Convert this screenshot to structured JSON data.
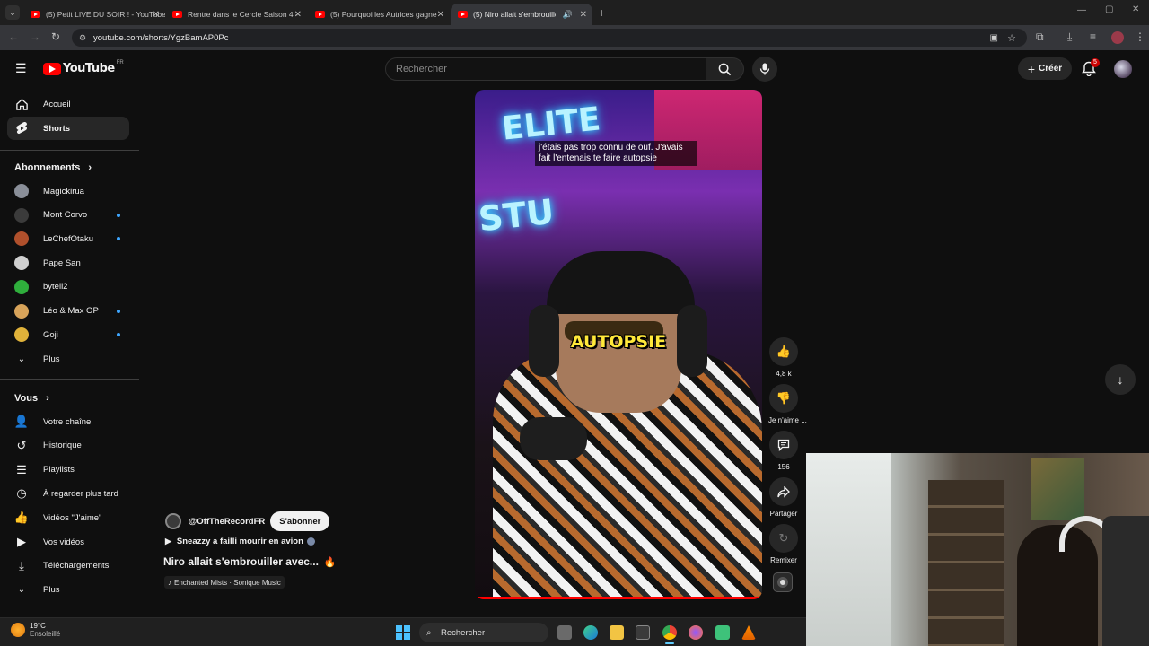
{
  "browser": {
    "tabs": [
      {
        "label": "(5) Petit LIVE DU SOIR ! - YouTube"
      },
      {
        "label": "Rentre dans le Cercle Saison 4 -"
      },
      {
        "label": "(5) Pourquoi les Autrices gagne"
      },
      {
        "label": "(5) Niro allait s'embrouiller"
      }
    ],
    "url": "youtube.com/shorts/YgzBamAP0Pc"
  },
  "youtube": {
    "logo": "YouTube",
    "region": "FR",
    "search_placeholder": "Rechercher",
    "create_label": "Créer",
    "notification_count": "5"
  },
  "sidebar": {
    "main": [
      {
        "label": "Accueil",
        "icon": "home-icon"
      },
      {
        "label": "Shorts",
        "icon": "shorts-icon"
      }
    ],
    "subscriptions_title": "Abonnements",
    "subscriptions": [
      {
        "label": "Magickirua",
        "color": "#8a8f99",
        "dot": false
      },
      {
        "label": "Mont Corvo",
        "color": "#3b3b3b",
        "dot": true
      },
      {
        "label": "LeChefOtaku",
        "color": "#b0502c",
        "dot": true
      },
      {
        "label": "Pape San",
        "color": "#cfcfcf",
        "dot": false
      },
      {
        "label": "bytell2",
        "color": "#2fae3c",
        "dot": false
      },
      {
        "label": "Léo & Max OP",
        "color": "#d7a35a",
        "dot": true
      },
      {
        "label": "Goji",
        "color": "#e0b23a",
        "dot": true
      }
    ],
    "more_subs": "Plus",
    "you_title": "Vous",
    "you": [
      {
        "label": "Votre chaîne",
        "icon": "channel-icon"
      },
      {
        "label": "Historique",
        "icon": "history-icon"
      },
      {
        "label": "Playlists",
        "icon": "playlists-icon"
      },
      {
        "label": "À regarder plus tard",
        "icon": "watch-later-icon"
      },
      {
        "label": "Vidéos \"J'aime\"",
        "icon": "liked-icon"
      },
      {
        "label": "Vos vidéos",
        "icon": "your-videos-icon"
      },
      {
        "label": "Téléchargements",
        "icon": "downloads-icon"
      }
    ],
    "more_you": "Plus"
  },
  "short": {
    "caption_line1": "j'étais pas trop connu de ouf. J'avais",
    "caption_line2": "fait l'entenais te faire autopsie",
    "overlay_word": "AUTOPSIE",
    "neon_top": "ELITE",
    "neon_mid": "STU",
    "likes": "4,8 k",
    "dislike_label": "Je n'aime ...",
    "comments": "156",
    "share_label": "Partager",
    "remix_label": "Remixer",
    "channel": "@OffTheRecordFR",
    "subscribe_label": "S'abonner",
    "linked_video": "Sneazzy a failli mourir en avion",
    "title": "Niro allait s'embrouiller avec...",
    "sound": "Enchanted Mists · Sonique Music"
  },
  "taskbar": {
    "weather_temp": "19°C",
    "weather_desc": "Ensoleillé",
    "search_placeholder": "Rechercher"
  }
}
